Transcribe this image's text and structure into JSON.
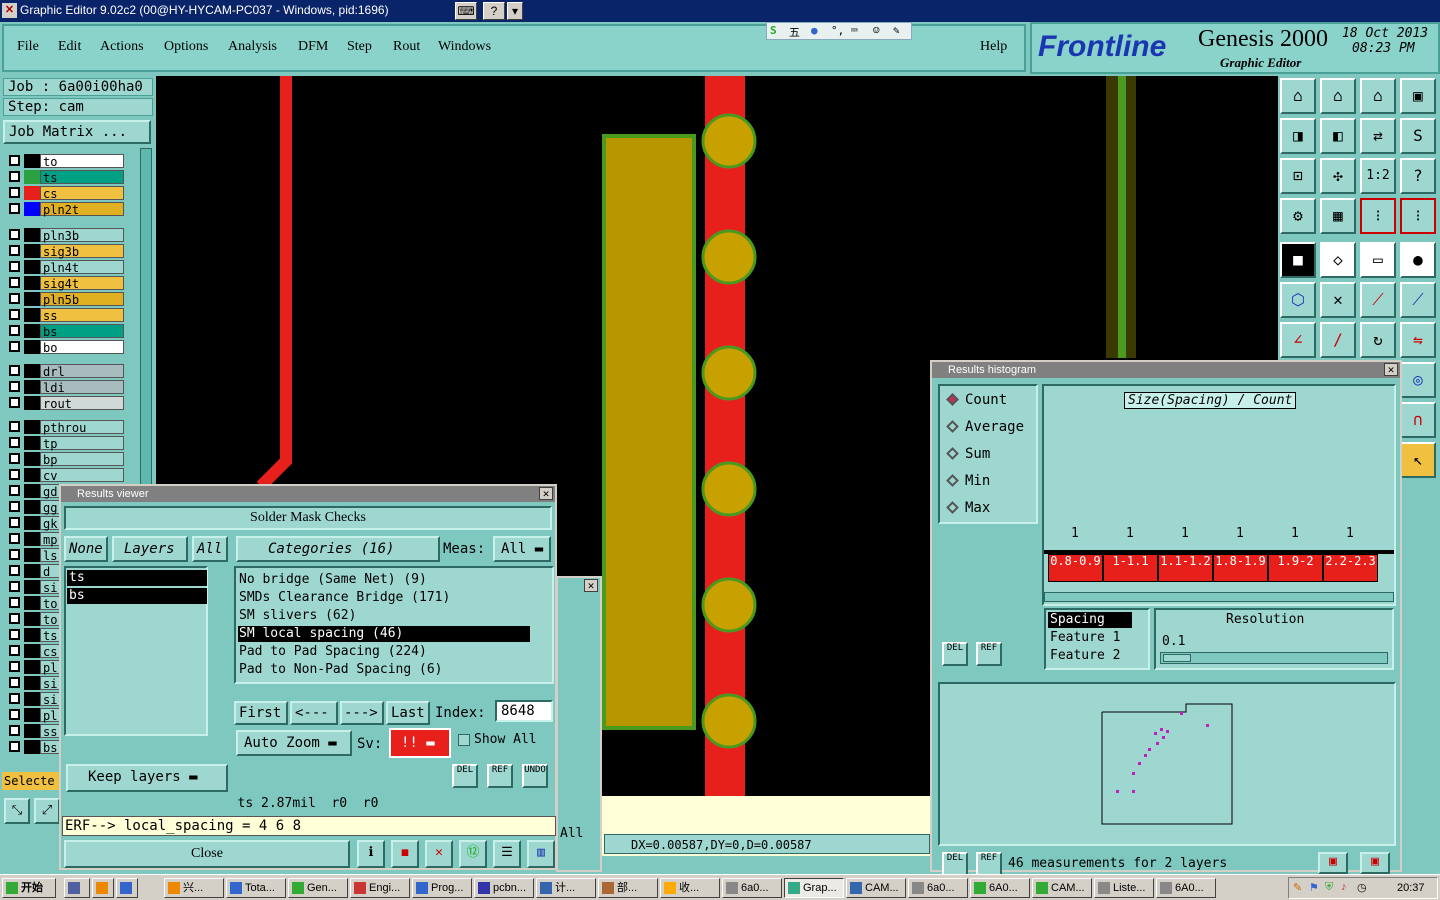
{
  "titlebar": {
    "title": "Graphic Editor 9.02c2 (00@HY-HYCAM-PC037 - Windows, pid:1696)"
  },
  "menu": [
    "File",
    "Edit",
    "Actions",
    "Options",
    "Analysis",
    "DFM",
    "Step",
    "Rout",
    "Windows"
  ],
  "help": "Help",
  "logo": {
    "brand": "Frontline",
    "product": "Genesis 2000",
    "subtitle": "Graphic Editor",
    "date": "18 Oct 2013",
    "time": "08:23 PM"
  },
  "job": {
    "job_label": "Job : 6a00i00ha0",
    "step_label": "Step: cam",
    "matrix_button": "Job Matrix ..."
  },
  "layers": [
    {
      "name": "to",
      "bg": "#ffffff",
      "sw": "#000000"
    },
    {
      "name": "ts",
      "bg": "#00a084",
      "sw": "#2aa040"
    },
    {
      "name": "cs",
      "bg": "#f0c040",
      "sw": "#e8201c"
    },
    {
      "name": "pln2t",
      "bg": "#e0b020",
      "sw": "#0000ff"
    },
    {
      "name": "pln3b",
      "bg": "#9ed7d0",
      "sw": "#000000"
    },
    {
      "name": "sig3b",
      "bg": "#f0c040",
      "sw": "#000000"
    },
    {
      "name": "pln4t",
      "bg": "#9ed7d0",
      "sw": "#000000"
    },
    {
      "name": "sig4t",
      "bg": "#f0c040",
      "sw": "#000000"
    },
    {
      "name": "pln5b",
      "bg": "#e0b020",
      "sw": "#000000"
    },
    {
      "name": "ss",
      "bg": "#f0c040",
      "sw": "#000000"
    },
    {
      "name": "bs",
      "bg": "#00a084",
      "sw": "#000000"
    },
    {
      "name": "bo",
      "bg": "#ffffff",
      "sw": "#000000"
    },
    {
      "name": "drl",
      "bg": "#a8bcc0",
      "sw": "#000000"
    },
    {
      "name": "ldi",
      "bg": "#a8bcc0",
      "sw": "#000000"
    },
    {
      "name": "rout",
      "bg": "#d0d8d8",
      "sw": "#000000"
    },
    {
      "name": "pthrou",
      "bg": "#9ed7d0",
      "sw": "#000000"
    },
    {
      "name": "tp",
      "bg": "#9ed7d0",
      "sw": "#000000"
    },
    {
      "name": "bp",
      "bg": "#9ed7d0",
      "sw": "#000000"
    },
    {
      "name": "cv",
      "bg": "#9ed7d0",
      "sw": "#000000"
    },
    {
      "name": "gd",
      "bg": "#9ed7d0",
      "sw": "#000000"
    },
    {
      "name": "gg",
      "bg": "#9ed7d0",
      "sw": "#000000"
    },
    {
      "name": "gk",
      "bg": "#9ed7d0",
      "sw": "#000000"
    },
    {
      "name": "mp",
      "bg": "#9ed7d0",
      "sw": "#000000"
    },
    {
      "name": "ls",
      "bg": "#9ed7d0",
      "sw": "#000000"
    },
    {
      "name": "d",
      "bg": "#9ed7d0",
      "sw": "#000000"
    },
    {
      "name": "si",
      "bg": "#9ed7d0",
      "sw": "#000000"
    },
    {
      "name": "to",
      "bg": "#9ed7d0",
      "sw": "#000000"
    },
    {
      "name": "to",
      "bg": "#9ed7d0",
      "sw": "#000000"
    },
    {
      "name": "ts",
      "bg": "#9ed7d0",
      "sw": "#000000"
    },
    {
      "name": "cs",
      "bg": "#9ed7d0",
      "sw": "#000000"
    },
    {
      "name": "pl",
      "bg": "#9ed7d0",
      "sw": "#000000"
    },
    {
      "name": "si",
      "bg": "#9ed7d0",
      "sw": "#000000"
    },
    {
      "name": "si",
      "bg": "#9ed7d0",
      "sw": "#000000"
    },
    {
      "name": "pl",
      "bg": "#9ed7d0",
      "sw": "#000000"
    },
    {
      "name": "ss",
      "bg": "#9ed7d0",
      "sw": "#000000"
    },
    {
      "name": "bs",
      "bg": "#9ed7d0",
      "sw": "#000000"
    }
  ],
  "selected_label": "Selecte",
  "results_viewer": {
    "title": "Results viewer",
    "heading": "Solder Mask Checks",
    "none_btn": "None",
    "layers_btn": "Layers",
    "all_btn": "All",
    "categories_label": "Categories (16)",
    "meas_label": "Meas:",
    "meas_value": "All",
    "layers_list": [
      "ts",
      "bs"
    ],
    "categories": [
      "No bridge (Same Net) (9)",
      "SMDs Clearance Bridge (171)",
      "SM slivers (62)",
      "SM local spacing (46)",
      "Pad to Pad Spacing (224)",
      "Pad to Non-Pad Spacing (6)"
    ],
    "selected_category": 3,
    "first": "First",
    "prev": "<---",
    "next": "--->",
    "last": "Last",
    "index_label": "Index:",
    "index_value": "8648",
    "auto_zoom": "Auto Zoom",
    "sv_label": "Sv:",
    "sv_value": "!!",
    "show_all": "Show All",
    "keep_layers": "Keep layers",
    "del": "DEL",
    "ref": "REF",
    "undo": "UNDO",
    "status": "ts 2.87mil  r0  r0",
    "erf": "ERF--> local_spacing = 4 6 8",
    "close": "Close"
  },
  "bg_dialog_text": "All",
  "coords": "DX=0.00587,DY=0,D=0.00587",
  "histogram": {
    "title": "Results histogram",
    "modes": [
      "Count",
      "Average",
      "Sum",
      "Min",
      "Max"
    ],
    "selected_mode": "Count",
    "chart_title": "Size(Spacing) / Count",
    "spacing_list": [
      "Spacing",
      "Feature 1",
      "Feature 2"
    ],
    "resolution_label": "Resolution",
    "resolution_value": "0.1",
    "status": "46 measurements for 2 layers",
    "del": "DEL",
    "ref": "REF"
  },
  "chart_data": {
    "type": "bar",
    "title": "Size(Spacing) / Count",
    "categories": [
      "0.8-0.9",
      "1-1.1",
      "1.1-1.2",
      "1.8-1.9",
      "1.9-2",
      "2.2-2.3"
    ],
    "values": [
      1,
      1,
      1,
      1,
      1,
      1
    ]
  },
  "taskbar": {
    "start": "开始",
    "tasks": [
      "兴...",
      "Tota...",
      "Gen...",
      "Engi...",
      "Prog...",
      "pcbn...",
      "计...",
      "部...",
      "收...",
      "6a0...",
      "Grap...",
      "CAM...",
      "6a0...",
      "6A0...",
      "CAM...",
      "Liste...",
      "6A0..."
    ],
    "clock": "20:37"
  },
  "colors": {
    "panel": "#7fc8c0",
    "copper": "#b89600",
    "trace": "#e8201c",
    "pad": "#c8a000",
    "pad_ring": "#4a9a20"
  }
}
